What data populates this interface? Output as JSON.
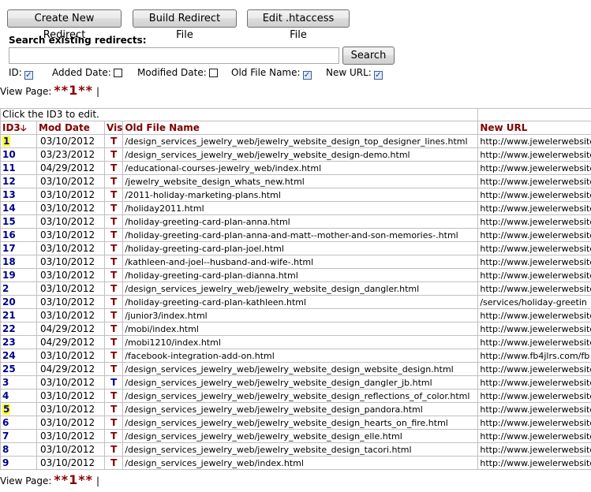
{
  "toolbar": {
    "create_label": "Create New Redirect",
    "build_label": "Build Redirect File",
    "edit_label": "Edit .htaccess File"
  },
  "search": {
    "label": "Search existing redirects:",
    "value": "",
    "button_label": "Search"
  },
  "filters": [
    {
      "label": "ID:",
      "checked": true
    },
    {
      "label": "Added Date:",
      "checked": false
    },
    {
      "label": "Modified Date:",
      "checked": false
    },
    {
      "label": "Old File Name:",
      "checked": true
    },
    {
      "label": "New URL:",
      "checked": true
    }
  ],
  "pager": {
    "label": "View Page:",
    "current": "**1**",
    "separator": "|"
  },
  "table": {
    "caption": "Click the ID3 to edit.",
    "headers": {
      "id": "ID3",
      "mod_date": "Mod Date",
      "vis": "Vis",
      "old": "Old File Name",
      "new": "New URL"
    },
    "sort_icon": "arrow-down-icon",
    "rows": [
      {
        "id": "1",
        "date": "03/10/2012",
        "vis": "T",
        "old": "/design_services_jewelry_web/jewelry_website_design_top_designer_lines.html",
        "new": "http://www.jewelerwebsite",
        "hl": true,
        "visblue": false
      },
      {
        "id": "10",
        "date": "03/23/2012",
        "vis": "T",
        "old": "/design_services_jewelry_web/jewelry_website_design-demo.html",
        "new": "http://www.jewelerwebsite",
        "hl": false,
        "visblue": false
      },
      {
        "id": "11",
        "date": "04/29/2012",
        "vis": "T",
        "old": "/educational-courses-jewelry_web/index.html",
        "new": "http://www.jewelerwebsite",
        "hl": false,
        "visblue": false
      },
      {
        "id": "12",
        "date": "03/10/2012",
        "vis": "T",
        "old": "/jewelry_website_design_whats_new.html",
        "new": "http://www.jewelerwebsite",
        "hl": false,
        "visblue": false
      },
      {
        "id": "13",
        "date": "03/10/2012",
        "vis": "T",
        "old": "/2011-holiday-marketing-plans.html",
        "new": "http://www.jewelerwebsite",
        "hl": false,
        "visblue": false
      },
      {
        "id": "14",
        "date": "03/10/2012",
        "vis": "T",
        "old": "/holiday2011.html",
        "new": "http://www.jewelerwebsite",
        "hl": false,
        "visblue": false
      },
      {
        "id": "15",
        "date": "03/10/2012",
        "vis": "T",
        "old": "/holiday-greeting-card-plan-anna.html",
        "new": "http://www.jewelerwebsite",
        "hl": false,
        "visblue": false
      },
      {
        "id": "16",
        "date": "03/10/2012",
        "vis": "T",
        "old": "/holiday-greeting-card-plan-anna-and-matt--mother-and-son-memories-.html",
        "new": "http://www.jewelerwebsite",
        "hl": false,
        "visblue": false
      },
      {
        "id": "17",
        "date": "03/10/2012",
        "vis": "T",
        "old": "/holiday-greeting-card-plan-joel.html",
        "new": "http://www.jewelerwebsite",
        "hl": false,
        "visblue": false
      },
      {
        "id": "18",
        "date": "03/10/2012",
        "vis": "T",
        "old": "/kathleen-and-joel--husband-and-wife-.html",
        "new": "http://www.jewelerwebsite",
        "hl": false,
        "visblue": false
      },
      {
        "id": "19",
        "date": "03/10/2012",
        "vis": "T",
        "old": "/holiday-greeting-card-plan-dianna.html",
        "new": "http://www.jewelerwebsite",
        "hl": false,
        "visblue": false
      },
      {
        "id": "2",
        "date": "03/10/2012",
        "vis": "T",
        "old": "/design_services_jewelry_web/jewelry_website_design_dangler.html",
        "new": "http://www.jewelerwebsite",
        "hl": false,
        "visblue": false
      },
      {
        "id": "20",
        "date": "03/10/2012",
        "vis": "T",
        "old": "/holiday-greeting-card-plan-kathleen.html",
        "new": "/services/holiday-greetin",
        "hl": false,
        "visblue": false
      },
      {
        "id": "21",
        "date": "03/10/2012",
        "vis": "T",
        "old": "/junior3/index.html",
        "new": "http://www.jewelerwebsite",
        "hl": false,
        "visblue": false
      },
      {
        "id": "22",
        "date": "04/29/2012",
        "vis": "T",
        "old": "/mobi/index.html",
        "new": "http://www.jewelerwebsite",
        "hl": false,
        "visblue": false
      },
      {
        "id": "23",
        "date": "04/29/2012",
        "vis": "T",
        "old": "/mobi1210/index.html",
        "new": "http://www.jewelerwebsite",
        "hl": false,
        "visblue": false
      },
      {
        "id": "24",
        "date": "03/10/2012",
        "vis": "T",
        "old": "/facebook-integration-add-on.html",
        "new": "http://www.fb4jlrs.com/fb",
        "hl": false,
        "visblue": false
      },
      {
        "id": "25",
        "date": "04/29/2012",
        "vis": "T",
        "old": "/design_services_jewelry_web/jewelry_website_design_website_design.html",
        "new": "http://www.jewelerwebsite",
        "hl": false,
        "visblue": false
      },
      {
        "id": "3",
        "date": "03/10/2012",
        "vis": "T",
        "old": "/design_services_jewelry_web/jewelry_website_design_dangler_jb.html",
        "new": "http://www.jewelerwebsite",
        "hl": false,
        "visblue": true
      },
      {
        "id": "4",
        "date": "03/10/2012",
        "vis": "T",
        "old": "/design_services_jewelry_web/jewelry_website_design_reflections_of_color.html",
        "new": "http://www.jewelerwebsite",
        "hl": false,
        "visblue": false
      },
      {
        "id": "5",
        "date": "03/10/2012",
        "vis": "T",
        "old": "/design_services_jewelry_web/jewelry_website_design_pandora.html",
        "new": "http://www.jewelerwebsite",
        "hl": true,
        "visblue": false
      },
      {
        "id": "6",
        "date": "03/10/2012",
        "vis": "T",
        "old": "/design_services_jewelry_web/jewelry_website_design_hearts_on_fire.html",
        "new": "http://www.jewelerwebsite",
        "hl": false,
        "visblue": false
      },
      {
        "id": "7",
        "date": "03/10/2012",
        "vis": "T",
        "old": "/design_services_jewelry_web/jewelry_website_design_elle.html",
        "new": "http://www.jewelerwebsite",
        "hl": false,
        "visblue": false
      },
      {
        "id": "8",
        "date": "03/10/2012",
        "vis": "T",
        "old": "/design_services_jewelry_web/jewelry_website_design_tacori.html",
        "new": "http://www.jewelerwebsite",
        "hl": false,
        "visblue": false
      },
      {
        "id": "9",
        "date": "03/10/2012",
        "vis": "T",
        "old": "/design_services_jewelry_web/index.html",
        "new": "http://www.jewelerwebsite",
        "hl": false,
        "visblue": false
      }
    ]
  }
}
